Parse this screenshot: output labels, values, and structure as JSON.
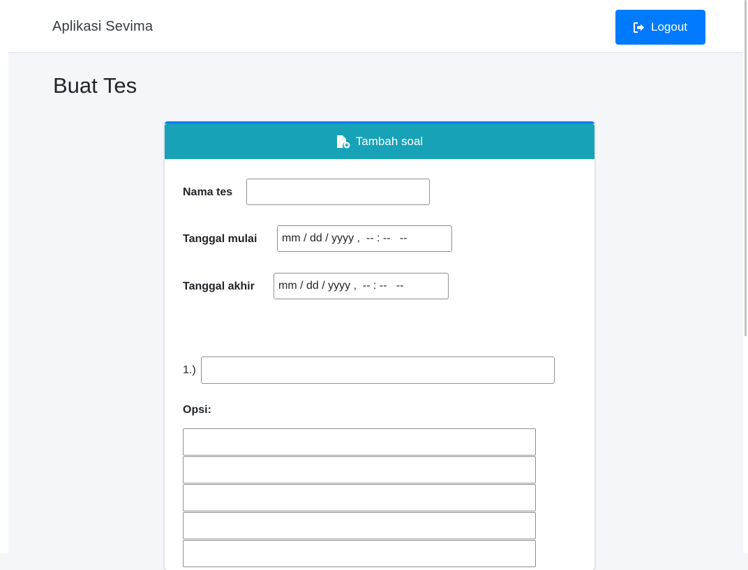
{
  "navbar": {
    "brand": "Aplikasi Sevima",
    "logout_label": "Logout"
  },
  "page": {
    "title": "Buat Tes"
  },
  "card": {
    "header_label": "Tambah soal",
    "nama_tes_label": "Nama tes",
    "nama_tes_value": "",
    "tanggal_mulai_label": "Tanggal mulai",
    "tanggal_mulai_placeholder": "mm / dd / yyyy ,  -- : --   --",
    "tanggal_akhir_label": "Tanggal akhir",
    "tanggal_akhir_placeholder": "mm / dd / yyyy ,  -- : --   --",
    "question_number": "1.)",
    "question_value": "",
    "opsi_label": "Opsi:",
    "options": [
      "",
      "",
      "",
      "",
      ""
    ]
  },
  "colors": {
    "primary": "#007bff",
    "info": "#17a2b8",
    "background": "#f4f6f9"
  },
  "icons": {
    "logout": "sign-out-icon",
    "add_file": "file-plus-icon"
  }
}
